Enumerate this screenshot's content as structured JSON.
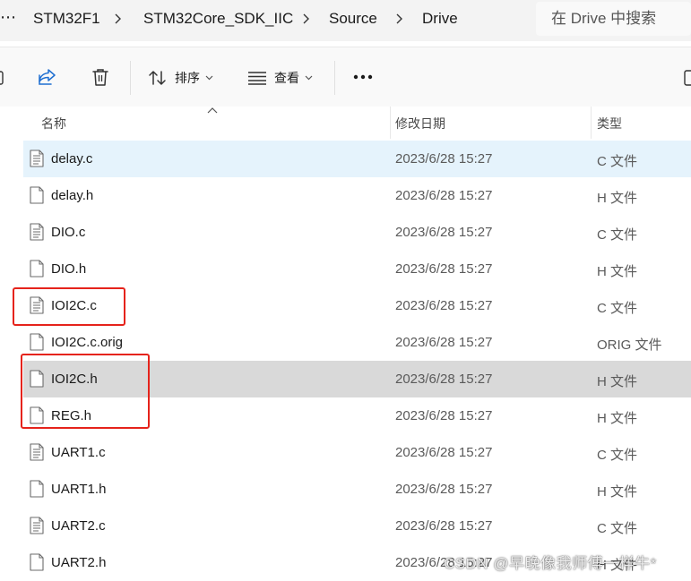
{
  "breadcrumb": {
    "overflow": "⋯",
    "items": [
      "STM32F1",
      "STM32Core_SDK_IIC",
      "Source",
      "Drive"
    ]
  },
  "search": {
    "placeholder": "在 Drive 中搜索"
  },
  "toolbar": {
    "sort_label": "排序",
    "view_label": "查看"
  },
  "columns": {
    "name": "名称",
    "modified": "修改日期",
    "type": "类型"
  },
  "files": [
    {
      "name": "delay.c",
      "modified": "2023/6/28 15:27",
      "type": "C 文件",
      "icon": "code-file-icon"
    },
    {
      "name": "delay.h",
      "modified": "2023/6/28 15:27",
      "type": "H 文件",
      "icon": "blank-file-icon"
    },
    {
      "name": "DIO.c",
      "modified": "2023/6/28 15:27",
      "type": "C 文件",
      "icon": "code-file-icon"
    },
    {
      "name": "DIO.h",
      "modified": "2023/6/28 15:27",
      "type": "H 文件",
      "icon": "blank-file-icon"
    },
    {
      "name": "IOI2C.c",
      "modified": "2023/6/28 15:27",
      "type": "C 文件",
      "icon": "code-file-icon"
    },
    {
      "name": "IOI2C.c.orig",
      "modified": "2023/6/28 15:27",
      "type": "ORIG 文件",
      "icon": "blank-file-icon"
    },
    {
      "name": "IOI2C.h",
      "modified": "2023/6/28 15:27",
      "type": "H 文件",
      "icon": "blank-file-icon"
    },
    {
      "name": "REG.h",
      "modified": "2023/6/28 15:27",
      "type": "H 文件",
      "icon": "blank-file-icon"
    },
    {
      "name": "UART1.c",
      "modified": "2023/6/28 15:27",
      "type": "C 文件",
      "icon": "code-file-icon"
    },
    {
      "name": "UART1.h",
      "modified": "2023/6/28 15:27",
      "type": "H 文件",
      "icon": "blank-file-icon"
    },
    {
      "name": "UART2.c",
      "modified": "2023/6/28 15:27",
      "type": "C 文件",
      "icon": "code-file-icon"
    },
    {
      "name": "UART2.h",
      "modified": "2023/6/28 15:27",
      "type": "H 文件",
      "icon": "blank-file-icon"
    }
  ],
  "selected_file": "delay.c",
  "hovered_file": "IOI2C.h",
  "highlighted_files": [
    "IOI2C.c",
    "IOI2C.h",
    "REG.h"
  ],
  "colors": {
    "selected_row": "#e5f3fc",
    "hovered_row": "#d9d9d9",
    "highlight_box": "#e5231b",
    "share_icon": "#1f6fd1"
  },
  "watermark": "CSDN @早晚像我师傅一样牛*"
}
